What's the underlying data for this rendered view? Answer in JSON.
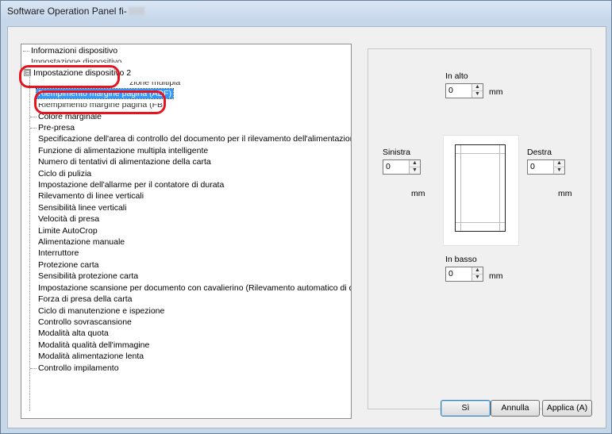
{
  "window": {
    "title": "Software Operation Panel fi-"
  },
  "tree": {
    "items": [
      {
        "label": "Informazioni dispositivo"
      },
      {
        "label": "Impostazione dispositivo"
      },
      {
        "label": "Impostazione dispositivo 2",
        "expanded": true
      },
      {
        "label": "zione multipla"
      },
      {
        "label": "Riempimento margine pagina (ADF)",
        "selected": true
      },
      {
        "label": "Riempimento margine pagina (FB)"
      },
      {
        "label": "Colore marginale"
      },
      {
        "label": "Pre-presa"
      },
      {
        "label": "Specificazione dell'area di controllo del documento per il rilevamento dell'alimentazione multipla"
      },
      {
        "label": "Funzione di alimentazione multipla intelligente"
      },
      {
        "label": "Numero di tentativi di alimentazione della carta"
      },
      {
        "label": "Ciclo di pulizia"
      },
      {
        "label": "Impostazione dell'allarme per il contatore di durata"
      },
      {
        "label": "Rilevamento di linee verticali"
      },
      {
        "label": "Sensibilità linee verticali"
      },
      {
        "label": "Velocità di presa"
      },
      {
        "label": "Limite AutoCrop"
      },
      {
        "label": "Alimentazione manuale"
      },
      {
        "label": "Interruttore"
      },
      {
        "label": "Protezione carta"
      },
      {
        "label": "Sensibilità protezione carta"
      },
      {
        "label": "Impostazione scansione per documento con cavalierino (Rilevamento automatico di dimensione pagina)"
      },
      {
        "label": "Forza di presa della carta"
      },
      {
        "label": "Ciclo di manutenzione e ispezione"
      },
      {
        "label": "Controllo sovrascansione"
      },
      {
        "label": "Modalità alta quota"
      },
      {
        "label": "Modalità qualità dell'immagine"
      },
      {
        "label": "Modalità alimentazione lenta"
      },
      {
        "label": "Controllo impilamento"
      }
    ],
    "expander_symbol": "⊟"
  },
  "margins": {
    "top": {
      "label": "In alto",
      "value": "0",
      "unit": "mm"
    },
    "left": {
      "label": "Sinistra",
      "value": "0",
      "unit": "mm"
    },
    "right": {
      "label": "Destra",
      "value": "0",
      "unit": "mm"
    },
    "bottom": {
      "label": "In basso",
      "value": "0",
      "unit": "mm"
    }
  },
  "buttons": {
    "ok": "Sì",
    "cancel": "Annulla",
    "apply": "Applica (A)"
  },
  "colors": {
    "selection": "#3399ff",
    "highlight_ring": "#e8141d"
  }
}
